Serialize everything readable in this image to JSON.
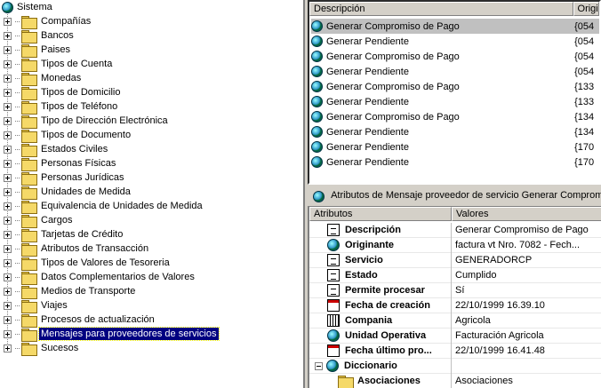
{
  "tree": {
    "root_label": "Sistema",
    "items": [
      {
        "label": "Compañías",
        "icon": "org-icon"
      },
      {
        "label": "Bancos",
        "icon": "folder-icon"
      },
      {
        "label": "Paises",
        "icon": "globe-folder-icon"
      },
      {
        "label": "Tipos de Cuenta",
        "icon": "folder-icon"
      },
      {
        "label": "Monedas",
        "icon": "folder-icon"
      },
      {
        "label": "Tipos de Domicilio",
        "icon": "domicile-icon"
      },
      {
        "label": "Tipos de Teléfono",
        "icon": "phone-icon"
      },
      {
        "label": "Tipo de Dirección Electrónica",
        "icon": "email-icon"
      },
      {
        "label": "Tipos de Documento",
        "icon": "document-icon"
      },
      {
        "label": "Estados Civiles",
        "icon": "folder-icon"
      },
      {
        "label": "Personas Físicas",
        "icon": "folder-icon"
      },
      {
        "label": "Personas Jurídicas",
        "icon": "folder-icon"
      },
      {
        "label": "Unidades de Medida",
        "icon": "ruler-icon"
      },
      {
        "label": "Equivalencia de Unidades de Medida",
        "icon": "folder-icon"
      },
      {
        "label": "Cargos",
        "icon": "folder-icon"
      },
      {
        "label": "Tarjetas de Crédito",
        "icon": "folder-icon"
      },
      {
        "label": "Atributos de Transacción",
        "icon": "folder-icon"
      },
      {
        "label": "Tipos de Valores de Tesoreria",
        "icon": "folder-icon"
      },
      {
        "label": "Datos Complementarios de Valores",
        "icon": "folder-icon"
      },
      {
        "label": "Medios de Transporte",
        "icon": "folder-icon"
      },
      {
        "label": "Viajes",
        "icon": "folder-icon"
      },
      {
        "label": "Procesos de actualización",
        "icon": "folder-icon"
      },
      {
        "label": "Mensajes para proveedores de servicios",
        "icon": "folder-icon",
        "selected": true
      },
      {
        "label": "Sucesos",
        "icon": "folder-icon"
      }
    ]
  },
  "list": {
    "columns": [
      "Descripción",
      "Origi"
    ],
    "rows": [
      {
        "desc": "Generar Compromiso de Pago",
        "orig": "{054"
      },
      {
        "desc": "Generar Pendiente",
        "orig": "{054"
      },
      {
        "desc": "Generar Compromiso de Pago",
        "orig": "{054"
      },
      {
        "desc": "Generar Pendiente",
        "orig": "{054"
      },
      {
        "desc": "Generar Compromiso de Pago",
        "orig": "{133"
      },
      {
        "desc": "Generar Pendiente",
        "orig": "{133"
      },
      {
        "desc": "Generar Compromiso de Pago",
        "orig": "{134"
      },
      {
        "desc": "Generar Pendiente",
        "orig": "{134"
      },
      {
        "desc": "Generar Pendiente",
        "orig": "{170"
      },
      {
        "desc": "Generar Pendiente",
        "orig": "{170"
      }
    ]
  },
  "attr_bar": {
    "prefix": "Atributos de",
    "title": "Mensaje proveedor de servicio Generar Compromi..."
  },
  "props": {
    "columns": [
      "Atributos",
      "Valores"
    ],
    "rows": [
      {
        "name": "Descripción",
        "value": "Generar Compromiso de Pago",
        "icon": "doc"
      },
      {
        "name": "Originante",
        "value": "factura vt Nro.  7082 - Fech...",
        "icon": "globe2"
      },
      {
        "name": "Servicio",
        "value": "GENERADORCP",
        "icon": "doc"
      },
      {
        "name": "Estado",
        "value": "Cumplido",
        "icon": "doc"
      },
      {
        "name": "Permite procesar",
        "value": "Sí",
        "icon": "doc"
      },
      {
        "name": "Fecha de creación",
        "value": "22/10/1999 16.39.10",
        "icon": "cal"
      },
      {
        "name": "Compania",
        "value": "Agricola",
        "icon": "bldg"
      },
      {
        "name": "Unidad Operativa",
        "value": "Facturación Agricola",
        "icon": "globe2"
      },
      {
        "name": "Fecha último pro...",
        "value": "22/10/1999 16.41.48",
        "icon": "cal"
      },
      {
        "name": "Diccionario",
        "value": "",
        "icon": "globe2"
      },
      {
        "name": "Asociaciones",
        "value": "Asociaciones",
        "icon": "folder"
      }
    ]
  }
}
